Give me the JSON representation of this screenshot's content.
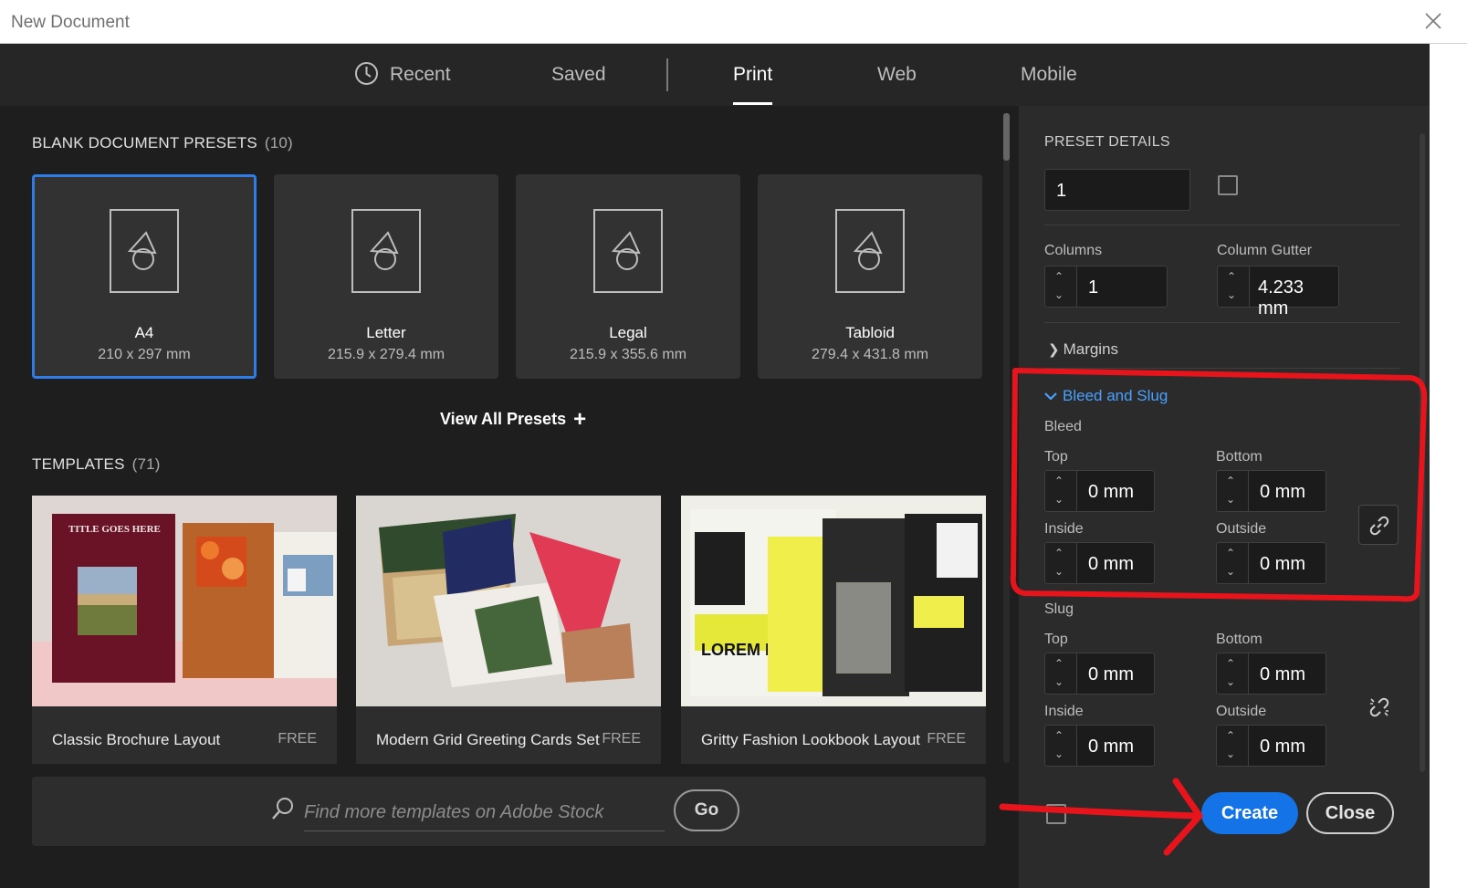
{
  "window": {
    "title": "New Document"
  },
  "tabs": [
    {
      "label": "Recent"
    },
    {
      "label": "Saved"
    },
    {
      "label": "Print"
    },
    {
      "label": "Web"
    },
    {
      "label": "Mobile"
    }
  ],
  "presets": {
    "title": "BLANK DOCUMENT PRESETS",
    "count": "(10)",
    "items": [
      {
        "name": "A4",
        "size": "210 x 297 mm"
      },
      {
        "name": "Letter",
        "size": "215.9 x 279.4 mm"
      },
      {
        "name": "Legal",
        "size": "215.9 x 355.6 mm"
      },
      {
        "name": "Tabloid",
        "size": "279.4 x 431.8 mm"
      }
    ],
    "view_all": "View All Presets"
  },
  "templates": {
    "title": "TEMPLATES",
    "count": "(71)",
    "items": [
      {
        "name": "Classic Brochure Layout",
        "price": "FREE",
        "thumb_text": "TITLE GOES HERE"
      },
      {
        "name": "Modern Grid Greeting Cards Set",
        "price": "FREE"
      },
      {
        "name": "Gritty Fashion Lookbook Layout",
        "price": "FREE",
        "thumb_text": "LOREM IP"
      }
    ]
  },
  "search": {
    "placeholder": "Find more templates on Adobe Stock",
    "go_label": "Go"
  },
  "details": {
    "heading": "PRESET DETAILS",
    "pages_value": "1",
    "columns_label": "Columns",
    "columns_value": "1",
    "gutter_label": "Column Gutter",
    "gutter_value": "4.233 mm",
    "margins_label": "Margins",
    "bleed_slug_label": "Bleed and Slug",
    "bleed": {
      "label": "Bleed",
      "top_label": "Top",
      "top": "0 mm",
      "bottom_label": "Bottom",
      "bottom": "0 mm",
      "inside_label": "Inside",
      "inside": "0 mm",
      "outside_label": "Outside",
      "outside": "0 mm"
    },
    "slug": {
      "label": "Slug",
      "top_label": "Top",
      "top": "0 mm",
      "bottom_label": "Bottom",
      "bottom": "0 mm",
      "inside_label": "Inside",
      "inside": "0 mm",
      "outside_label": "Outside",
      "outside": "0 mm"
    }
  },
  "actions": {
    "create": "Create",
    "close": "Close"
  },
  "colors": {
    "accent": "#1473e6",
    "link": "#4aa0ff",
    "annotation": "#e8141c",
    "selected_border": "#2e7ce6"
  }
}
